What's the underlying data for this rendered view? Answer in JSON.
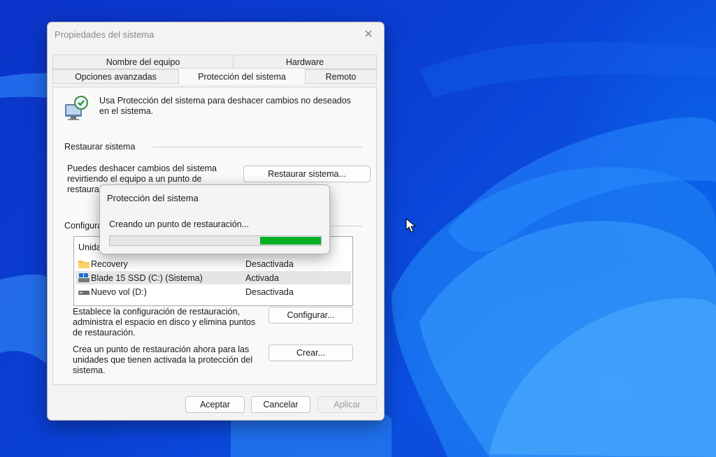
{
  "window": {
    "title": "Propiedades del sistema",
    "close_glyph": "✕"
  },
  "tabs": {
    "row1": [
      {
        "label": "Nombre del equipo"
      },
      {
        "label": "Hardware"
      }
    ],
    "row2": [
      {
        "label": "Opciones avanzadas"
      },
      {
        "label": "Protección del sistema",
        "active": true
      },
      {
        "label": "Remoto"
      }
    ]
  },
  "intro": {
    "icon": "system-protection-icon",
    "text_line1": "Usa Protección del sistema para deshacer cambios no deseados",
    "text_line2": "en el sistema."
  },
  "restore": {
    "group_label": "Restaurar sistema",
    "text_line1": "Puedes deshacer cambios del sistema",
    "text_line2": "revirtiendo el equipo a un punto de",
    "text_line3": "restauración",
    "button_label": "Restaurar sistema..."
  },
  "protection": {
    "group_label": "Configura",
    "list_header": "Unida",
    "drives": [
      {
        "name": "Recovery",
        "status": "Desactivada",
        "icon": "folder-icon"
      },
      {
        "name": "Blade 15 SSD (C:) (Sistema)",
        "status": "Activada",
        "icon": "system-drive-icon",
        "selected": true
      },
      {
        "name": "Nuevo vol (D:)",
        "status": "Desactivada",
        "icon": "drive-icon"
      }
    ],
    "config_text_line1": "Establece la configuración de restauración,",
    "config_text_line2": "administra el espacio en disco y elimina puntos",
    "config_text_line3": "de restauración.",
    "config_button": "Configurar...",
    "create_text_line1": "Crea un punto de restauración ahora para las",
    "create_text_line2": "unidades que tienen activada la protección del",
    "create_text_line3": "sistema.",
    "create_button": "Crear..."
  },
  "footer": {
    "ok": "Aceptar",
    "cancel": "Cancelar",
    "apply": "Aplicar"
  },
  "progress_dialog": {
    "title": "Protección del sistema",
    "message": "Creando un punto de restauración...",
    "progress_color": "#06b025",
    "progress_state": "marquee"
  },
  "colors": {
    "accent": "#06b025",
    "desktop": "#0b3fd3"
  }
}
